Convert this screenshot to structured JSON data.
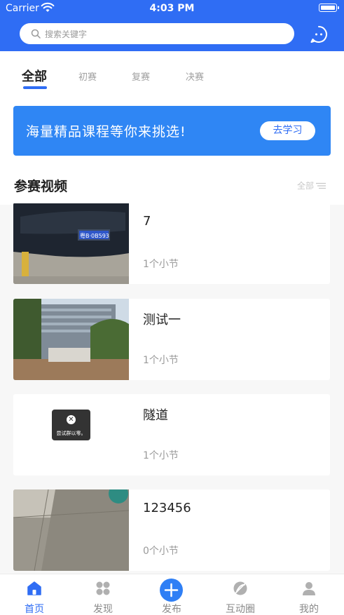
{
  "status_bar": {
    "carrier": "Carrier",
    "time": "4:03 PM"
  },
  "search": {
    "placeholder": "搜索关键字",
    "icon": "search-icon"
  },
  "header_icon": "message-icon",
  "tabs": [
    {
      "label": "全部",
      "active": true
    },
    {
      "label": "初赛",
      "active": false
    },
    {
      "label": "复赛",
      "active": false
    },
    {
      "label": "决赛",
      "active": false
    }
  ],
  "banner": {
    "text": "海量精品课程等你来挑选!",
    "button": "去学习"
  },
  "section": {
    "title": "参赛视频",
    "more": "全部"
  },
  "videos": [
    {
      "title": "7",
      "subtitle": "1个小节",
      "thumb": "car-photo",
      "plate_text": "粤B·0B593"
    },
    {
      "title": "测试一",
      "subtitle": "1个小节",
      "thumb": "building-photo"
    },
    {
      "title": "隧道",
      "subtitle": "1个小节",
      "thumb": "empty",
      "toast": "尝试群以零。"
    },
    {
      "title": "123456",
      "subtitle": "0个小节",
      "thumb": "floor-photo"
    }
  ],
  "tabbar": [
    {
      "label": "首页",
      "icon": "home-icon",
      "active": true
    },
    {
      "label": "发现",
      "icon": "discover-icon",
      "active": false
    },
    {
      "label": "发布",
      "icon": "plus-icon",
      "active": false
    },
    {
      "label": "互动圈",
      "icon": "circle-icon",
      "active": false
    },
    {
      "label": "我的",
      "icon": "user-icon",
      "active": false
    }
  ],
  "colors": {
    "primary": "#2f6df4",
    "banner": "#2f86f4",
    "muted": "#9a9a9a"
  }
}
